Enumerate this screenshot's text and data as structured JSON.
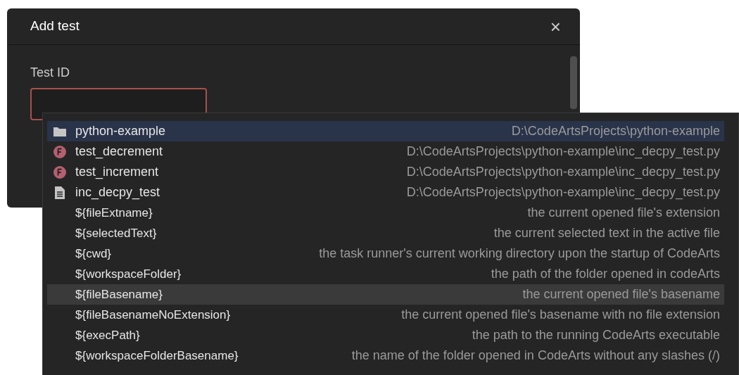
{
  "dialog": {
    "title": "Add test",
    "close": "×",
    "field": {
      "label": "Test ID",
      "invalid": true
    }
  },
  "suggestions": [
    {
      "kind": "folder",
      "label": "python-example",
      "detail": "D:\\CodeArtsProjects\\python-example",
      "selected": true,
      "hovered": false
    },
    {
      "kind": "function",
      "label": "test_decrement",
      "detail": "D:\\CodeArtsProjects\\python-example\\inc_decpy_test.py",
      "selected": false,
      "hovered": false
    },
    {
      "kind": "function",
      "label": "test_increment",
      "detail": "D:\\CodeArtsProjects\\python-example\\inc_decpy_test.py",
      "selected": false,
      "hovered": false
    },
    {
      "kind": "file",
      "label": "inc_decpy_test",
      "detail": "D:\\CodeArtsProjects\\python-example\\inc_decpy_test.py",
      "selected": false,
      "hovered": false
    },
    {
      "kind": "variable",
      "label": "${fileExtname}",
      "detail": "the current opened file's extension",
      "selected": false,
      "hovered": false
    },
    {
      "kind": "variable",
      "label": "${selectedText}",
      "detail": "the current selected text in the active file",
      "selected": false,
      "hovered": false
    },
    {
      "kind": "variable",
      "label": "${cwd}",
      "detail": "the task runner's current working directory upon the startup of CodeArts",
      "selected": false,
      "hovered": false
    },
    {
      "kind": "variable",
      "label": "${workspaceFolder}",
      "detail": "the path of the folder opened in codeArts",
      "selected": false,
      "hovered": false
    },
    {
      "kind": "variable",
      "label": "${fileBasename}",
      "detail": "the current opened file's basename",
      "selected": false,
      "hovered": true
    },
    {
      "kind": "variable",
      "label": "${fileBasenameNoExtension}",
      "detail": "the current opened file's basename with no file extension",
      "selected": false,
      "hovered": false
    },
    {
      "kind": "variable",
      "label": "${execPath}",
      "detail": "the path to the running CodeArts executable",
      "selected": false,
      "hovered": false
    },
    {
      "kind": "variable",
      "label": "${workspaceFolderBasename}",
      "detail": "the name of the folder opened in CodeArts without any slashes (/)",
      "selected": false,
      "hovered": false
    }
  ]
}
